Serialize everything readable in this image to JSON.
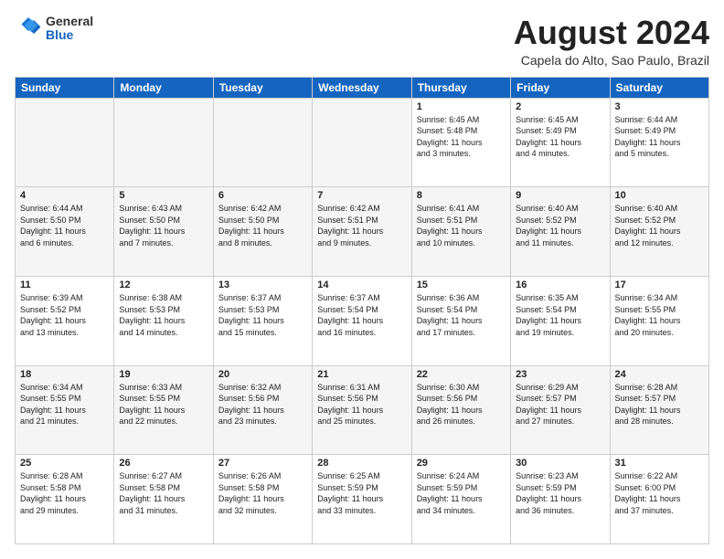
{
  "header": {
    "logo_general": "General",
    "logo_blue": "Blue",
    "month_title": "August 2024",
    "location": "Capela do Alto, Sao Paulo, Brazil"
  },
  "days_of_week": [
    "Sunday",
    "Monday",
    "Tuesday",
    "Wednesday",
    "Thursday",
    "Friday",
    "Saturday"
  ],
  "weeks": [
    [
      {
        "day": "",
        "info": ""
      },
      {
        "day": "",
        "info": ""
      },
      {
        "day": "",
        "info": ""
      },
      {
        "day": "",
        "info": ""
      },
      {
        "day": "1",
        "info": "Sunrise: 6:45 AM\nSunset: 5:48 PM\nDaylight: 11 hours\nand 3 minutes."
      },
      {
        "day": "2",
        "info": "Sunrise: 6:45 AM\nSunset: 5:49 PM\nDaylight: 11 hours\nand 4 minutes."
      },
      {
        "day": "3",
        "info": "Sunrise: 6:44 AM\nSunset: 5:49 PM\nDaylight: 11 hours\nand 5 minutes."
      }
    ],
    [
      {
        "day": "4",
        "info": "Sunrise: 6:44 AM\nSunset: 5:50 PM\nDaylight: 11 hours\nand 6 minutes."
      },
      {
        "day": "5",
        "info": "Sunrise: 6:43 AM\nSunset: 5:50 PM\nDaylight: 11 hours\nand 7 minutes."
      },
      {
        "day": "6",
        "info": "Sunrise: 6:42 AM\nSunset: 5:50 PM\nDaylight: 11 hours\nand 8 minutes."
      },
      {
        "day": "7",
        "info": "Sunrise: 6:42 AM\nSunset: 5:51 PM\nDaylight: 11 hours\nand 9 minutes."
      },
      {
        "day": "8",
        "info": "Sunrise: 6:41 AM\nSunset: 5:51 PM\nDaylight: 11 hours\nand 10 minutes."
      },
      {
        "day": "9",
        "info": "Sunrise: 6:40 AM\nSunset: 5:52 PM\nDaylight: 11 hours\nand 11 minutes."
      },
      {
        "day": "10",
        "info": "Sunrise: 6:40 AM\nSunset: 5:52 PM\nDaylight: 11 hours\nand 12 minutes."
      }
    ],
    [
      {
        "day": "11",
        "info": "Sunrise: 6:39 AM\nSunset: 5:52 PM\nDaylight: 11 hours\nand 13 minutes."
      },
      {
        "day": "12",
        "info": "Sunrise: 6:38 AM\nSunset: 5:53 PM\nDaylight: 11 hours\nand 14 minutes."
      },
      {
        "day": "13",
        "info": "Sunrise: 6:37 AM\nSunset: 5:53 PM\nDaylight: 11 hours\nand 15 minutes."
      },
      {
        "day": "14",
        "info": "Sunrise: 6:37 AM\nSunset: 5:54 PM\nDaylight: 11 hours\nand 16 minutes."
      },
      {
        "day": "15",
        "info": "Sunrise: 6:36 AM\nSunset: 5:54 PM\nDaylight: 11 hours\nand 17 minutes."
      },
      {
        "day": "16",
        "info": "Sunrise: 6:35 AM\nSunset: 5:54 PM\nDaylight: 11 hours\nand 19 minutes."
      },
      {
        "day": "17",
        "info": "Sunrise: 6:34 AM\nSunset: 5:55 PM\nDaylight: 11 hours\nand 20 minutes."
      }
    ],
    [
      {
        "day": "18",
        "info": "Sunrise: 6:34 AM\nSunset: 5:55 PM\nDaylight: 11 hours\nand 21 minutes."
      },
      {
        "day": "19",
        "info": "Sunrise: 6:33 AM\nSunset: 5:55 PM\nDaylight: 11 hours\nand 22 minutes."
      },
      {
        "day": "20",
        "info": "Sunrise: 6:32 AM\nSunset: 5:56 PM\nDaylight: 11 hours\nand 23 minutes."
      },
      {
        "day": "21",
        "info": "Sunrise: 6:31 AM\nSunset: 5:56 PM\nDaylight: 11 hours\nand 25 minutes."
      },
      {
        "day": "22",
        "info": "Sunrise: 6:30 AM\nSunset: 5:56 PM\nDaylight: 11 hours\nand 26 minutes."
      },
      {
        "day": "23",
        "info": "Sunrise: 6:29 AM\nSunset: 5:57 PM\nDaylight: 11 hours\nand 27 minutes."
      },
      {
        "day": "24",
        "info": "Sunrise: 6:28 AM\nSunset: 5:57 PM\nDaylight: 11 hours\nand 28 minutes."
      }
    ],
    [
      {
        "day": "25",
        "info": "Sunrise: 6:28 AM\nSunset: 5:58 PM\nDaylight: 11 hours\nand 29 minutes."
      },
      {
        "day": "26",
        "info": "Sunrise: 6:27 AM\nSunset: 5:58 PM\nDaylight: 11 hours\nand 31 minutes."
      },
      {
        "day": "27",
        "info": "Sunrise: 6:26 AM\nSunset: 5:58 PM\nDaylight: 11 hours\nand 32 minutes."
      },
      {
        "day": "28",
        "info": "Sunrise: 6:25 AM\nSunset: 5:59 PM\nDaylight: 11 hours\nand 33 minutes."
      },
      {
        "day": "29",
        "info": "Sunrise: 6:24 AM\nSunset: 5:59 PM\nDaylight: 11 hours\nand 34 minutes."
      },
      {
        "day": "30",
        "info": "Sunrise: 6:23 AM\nSunset: 5:59 PM\nDaylight: 11 hours\nand 36 minutes."
      },
      {
        "day": "31",
        "info": "Sunrise: 6:22 AM\nSunset: 6:00 PM\nDaylight: 11 hours\nand 37 minutes."
      }
    ]
  ]
}
